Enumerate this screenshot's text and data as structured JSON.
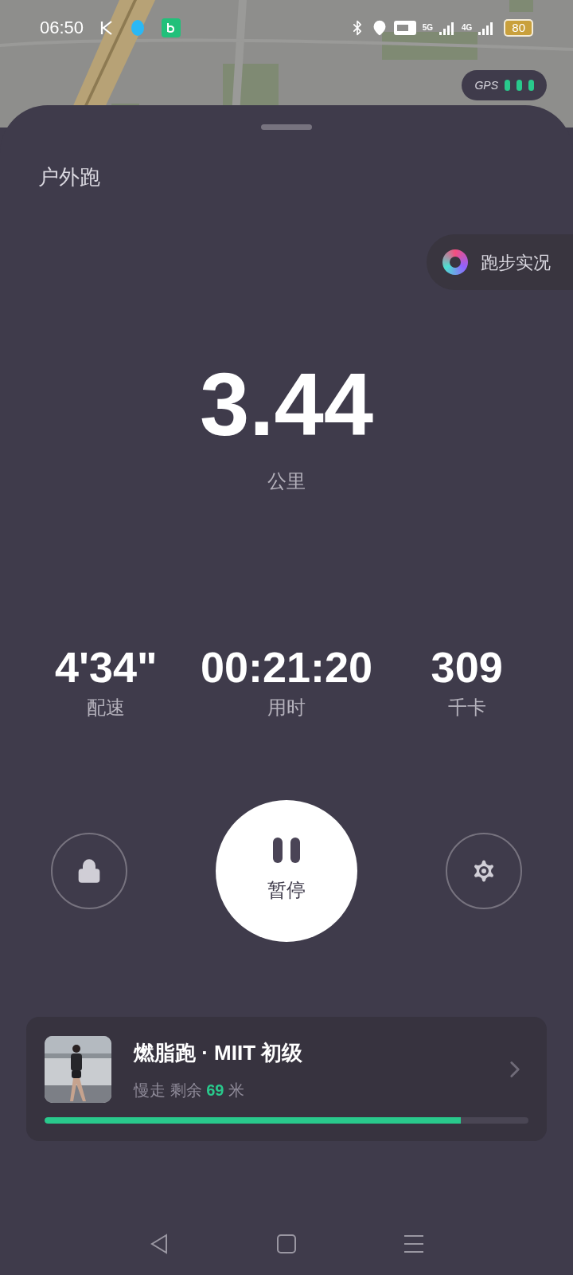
{
  "status_bar": {
    "time": "06:50",
    "battery": "80",
    "network_1": "5G",
    "network_2": "4G"
  },
  "gps": {
    "label": "GPS",
    "bars": [
      {
        "on": true
      },
      {
        "on": true
      },
      {
        "on": true
      }
    ]
  },
  "title": "户外跑",
  "live_button": "跑步实况",
  "distance": {
    "value": "3.44",
    "unit": "公里"
  },
  "stats": [
    {
      "value": "4'34\"",
      "label": "配速"
    },
    {
      "value": "00:21:20",
      "label": "用时"
    },
    {
      "value": "309",
      "label": "千卡"
    }
  ],
  "pause_button": "暂停",
  "plan": {
    "title": "燃脂跑 · MIIT 初级",
    "status": "慢走 剩余",
    "remaining": "69",
    "unit": "米",
    "level": 0.86
  }
}
